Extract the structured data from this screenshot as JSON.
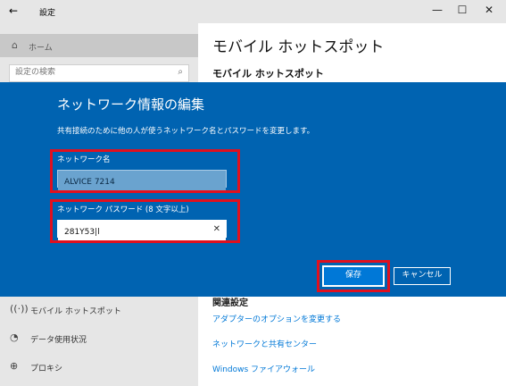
{
  "window": {
    "back_glyph": "←",
    "title": "設定",
    "minimize_glyph": "—",
    "maximize_glyph": "☐",
    "close_glyph": "✕"
  },
  "sidebar": {
    "home": {
      "icon": "home-icon",
      "label": "ホーム"
    },
    "search": {
      "placeholder": "設定の検索",
      "icon": "search-icon"
    },
    "items": [
      {
        "icon": "hotspot-icon",
        "label": "モバイル ホットスポット"
      },
      {
        "icon": "data-usage-icon",
        "label": "データ使用状況"
      },
      {
        "icon": "proxy-icon",
        "label": "プロキシ"
      }
    ]
  },
  "main": {
    "title": "モバイル ホットスポット",
    "subtitle": "モバイル ホットスポット",
    "related_heading": "関連設定",
    "related_links": [
      "アダプターのオプションを変更する",
      "ネットワークと共有センター",
      "Windows ファイアウォール"
    ]
  },
  "dialog": {
    "title": "ネットワーク情報の編集",
    "description": "共有接続のために他の人が使うネットワーク名とパスワードを変更します。",
    "network_name": {
      "label": "ネットワーク名",
      "value": "ALVICE 7214"
    },
    "password": {
      "label": "ネットワーク パスワード (8 文字以上)",
      "value": "281Y53|l",
      "clear_glyph": "✕"
    },
    "save_label": "保存",
    "cancel_label": "キャンセル"
  },
  "colors": {
    "dialog_bg": "#0063b1",
    "accent": "#0078d7",
    "highlight": "#e0101e"
  }
}
